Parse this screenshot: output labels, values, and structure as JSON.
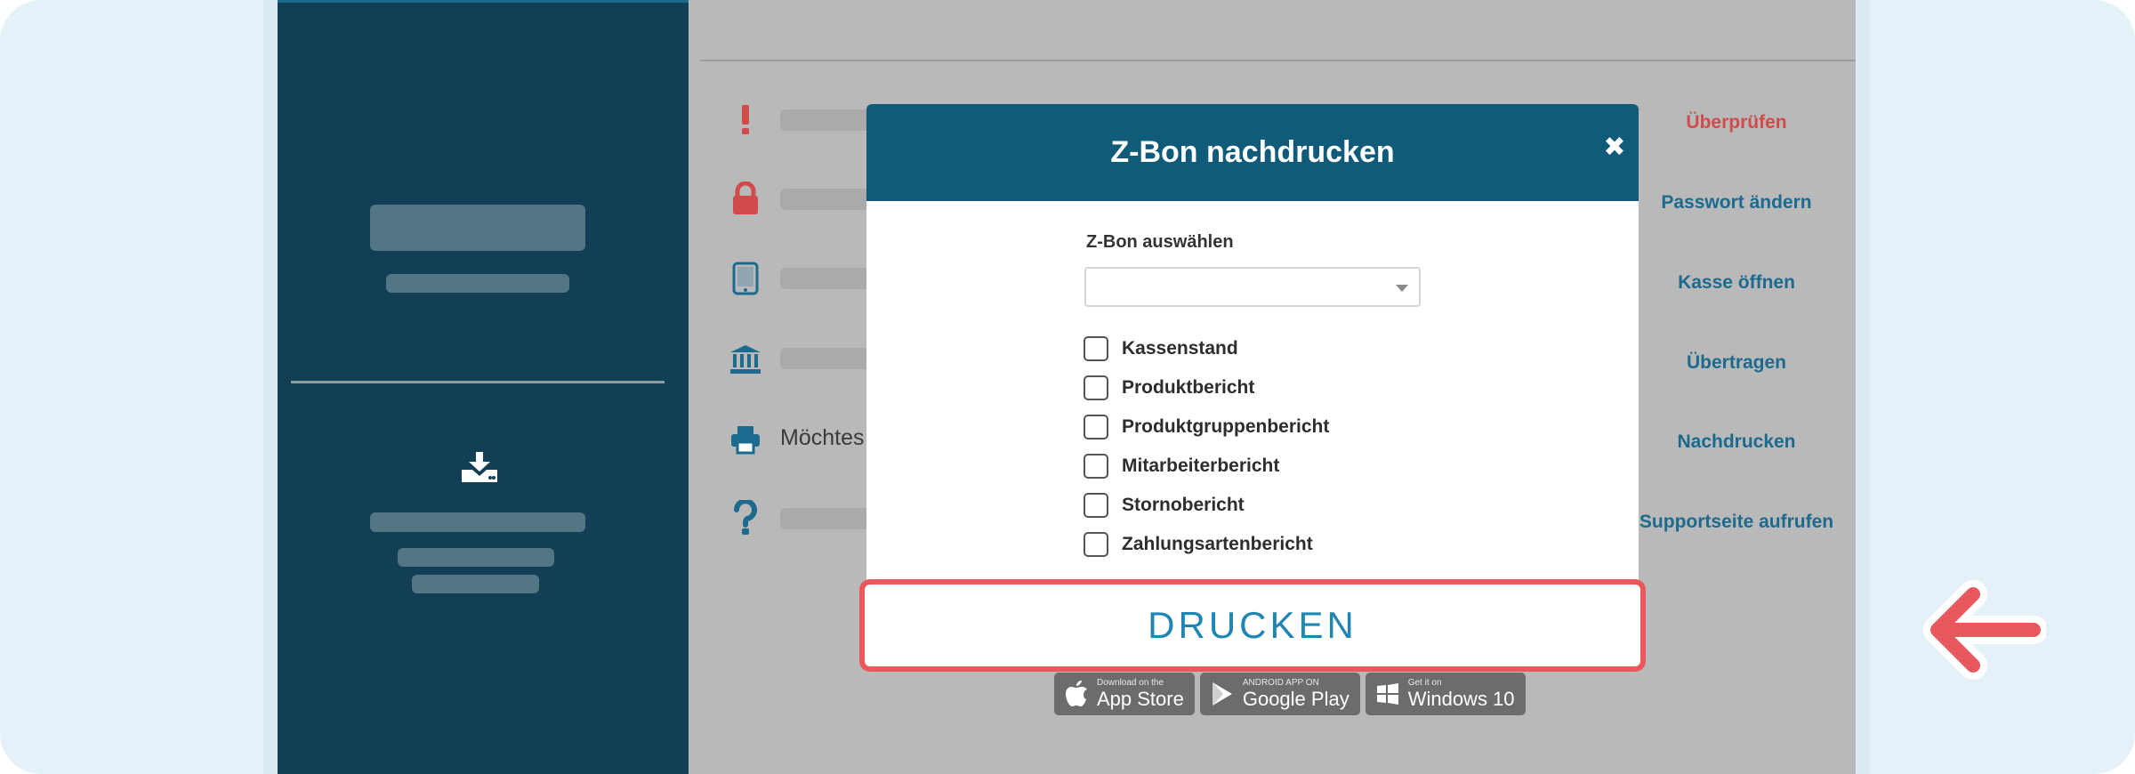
{
  "modal": {
    "title": "Z-Bon nachdrucken",
    "close_icon": "close-icon",
    "select_label": "Z-Bon auswählen",
    "select_value": "",
    "checkboxes": [
      {
        "label": "Kassenstand",
        "checked": false
      },
      {
        "label": "Produktbericht",
        "checked": false
      },
      {
        "label": "Produktgruppenbericht",
        "checked": false
      },
      {
        "label": "Mitarbeiterbericht",
        "checked": false
      },
      {
        "label": "Stornobericht",
        "checked": false
      },
      {
        "label": "Zahlungsartenbericht",
        "checked": false
      }
    ],
    "print_button": "DRUCKEN"
  },
  "main": {
    "partial_text": "Möchtes",
    "rows": [
      {
        "icon": "exclamation-icon",
        "action": "Überprüfen"
      },
      {
        "icon": "lock-icon",
        "action": "Passwort ändern"
      },
      {
        "icon": "tablet-icon",
        "action": "Kasse öffnen"
      },
      {
        "icon": "bank-icon",
        "action": "Übertragen"
      },
      {
        "icon": "printer-icon",
        "action": "Nachdrucken"
      },
      {
        "icon": "question-icon",
        "action": "Supportseite aufrufen"
      }
    ]
  },
  "sidebar": {
    "download_icon": "download-icon"
  },
  "store_badges": [
    {
      "small": "Download on the",
      "big": "App Store",
      "icon": "apple-icon"
    },
    {
      "small": "ANDROID APP ON",
      "big": "Google Play",
      "icon": "google-play-icon"
    },
    {
      "small": "Get it on",
      "big": "Windows 10",
      "icon": "windows-icon"
    }
  ],
  "colors": {
    "header": "#115b7a",
    "sidebar": "#123f55",
    "accent_link": "#1c6b8e",
    "danger": "#d14b4b",
    "highlight": "#e8585d"
  }
}
